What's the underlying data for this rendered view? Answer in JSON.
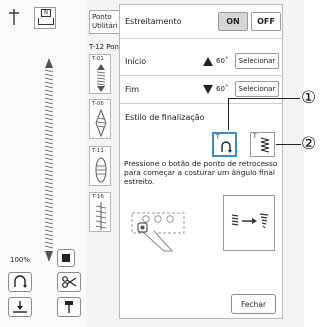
{
  "left": {
    "zoom": "100%"
  },
  "tab": {
    "line1": "Ponto",
    "line2": "Utilitári"
  },
  "pattern_group": "T-12 Pon",
  "stitches": [
    {
      "code": "T-01"
    },
    {
      "code": "T-06"
    },
    {
      "code": "T-11"
    },
    {
      "code": "T-16"
    }
  ],
  "dialog": {
    "estreitamento": "Estreitamento",
    "on": "ON",
    "off": "OFF",
    "inicio": "Início",
    "inicio_angle": "60˚",
    "fim": "Fim",
    "fim_angle": "60˚",
    "selecionar": "Selecionar",
    "estilo": "Estilo de finalização",
    "style_a": "T",
    "style_b": "T",
    "instruction": "Pressione o botão de ponto de retrocesso para começar a costurar um ângulo final estreito.",
    "fechar": "Fechar"
  },
  "callouts": {
    "one": "①",
    "two": "②"
  },
  "colors": {
    "accent": "#2f8fd8",
    "on_bg": "#d6d6d6"
  }
}
